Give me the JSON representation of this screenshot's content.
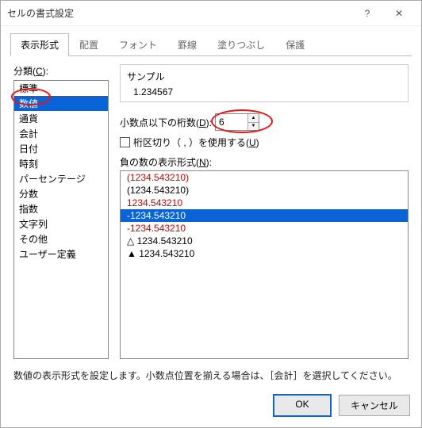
{
  "window": {
    "title": "セルの書式設定",
    "help_icon": "?",
    "close_icon": "✕"
  },
  "tabs": {
    "items": [
      {
        "label": "表示形式"
      },
      {
        "label": "配置"
      },
      {
        "label": "フォント"
      },
      {
        "label": "罫線"
      },
      {
        "label": "塗りつぶし"
      },
      {
        "label": "保護"
      }
    ]
  },
  "category": {
    "label_prefix": "分類(",
    "label_key": "C",
    "label_suffix": "):",
    "items": [
      "標準",
      "数値",
      "通貨",
      "会計",
      "日付",
      "時刻",
      "パーセンテージ",
      "分数",
      "指数",
      "文字列",
      "その他",
      "ユーザー定義"
    ],
    "selected_index": 1
  },
  "sample": {
    "title": "サンプル",
    "value": "1.234567"
  },
  "decimal": {
    "label_prefix": "小数点以下の桁数(",
    "label_key": "D",
    "label_suffix": "):",
    "value": "6"
  },
  "separator": {
    "label_prefix": "桁区切り（ , ）を使用する(",
    "label_key": "U",
    "label_suffix": ")",
    "checked": false
  },
  "negative": {
    "label_prefix": "負の数の表示形式(",
    "label_key": "N",
    "label_suffix": "):",
    "items": [
      {
        "text": "(1234.543210)",
        "color": "#d00000"
      },
      {
        "text": "(1234.543210)",
        "color": "#000000"
      },
      {
        "text": "1234.543210",
        "color": "#d00000"
      },
      {
        "text": "-1234.543210",
        "color": "#000000"
      },
      {
        "text": "-1234.543210",
        "color": "#d00000"
      },
      {
        "text": "△ 1234.543210",
        "color": "#000000"
      },
      {
        "text": "▲ 1234.543210",
        "color": "#000000"
      }
    ],
    "selected_index": 3
  },
  "description": "数値の表示形式を設定します。小数点位置を揃える場合は、［会計］を選択してください。",
  "buttons": {
    "ok": "OK",
    "cancel": "キャンセル"
  }
}
